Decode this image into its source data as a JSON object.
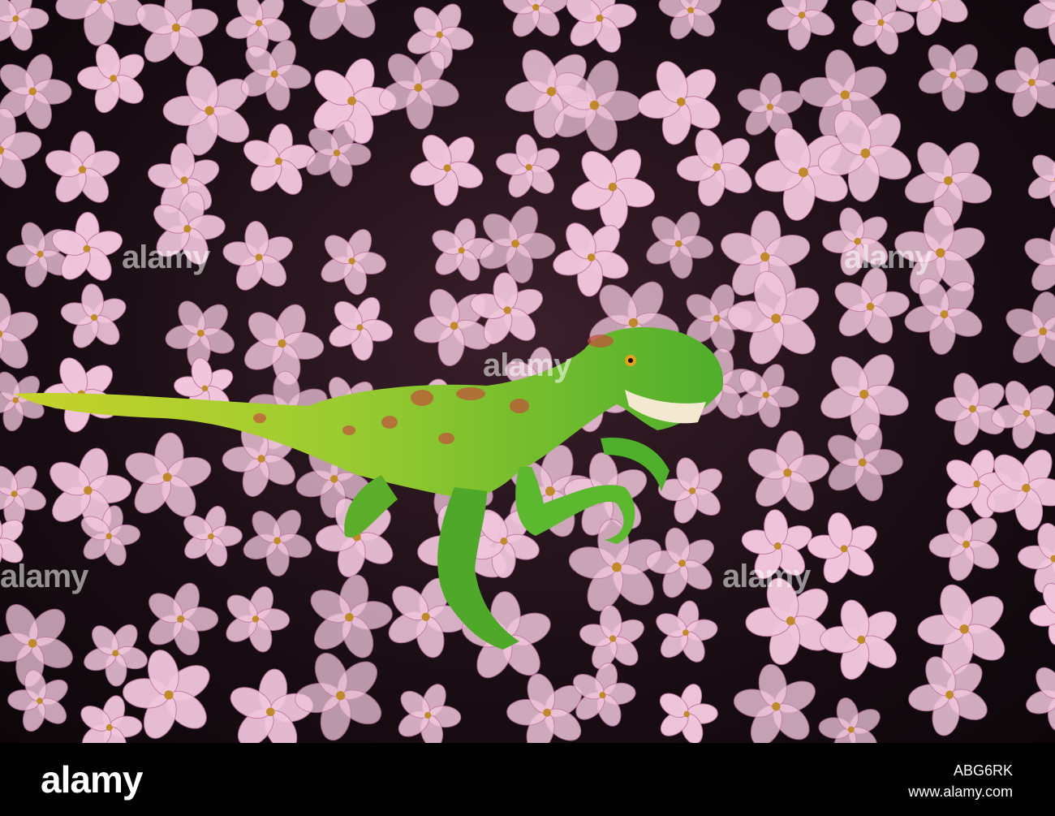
{
  "photo": {
    "subject": "toy-dinosaur-among-pink-flowers",
    "watermark_text": "alamy",
    "colors": {
      "flower": "#f1c6dc",
      "flower_edge": "#c27aa6",
      "center": "#c08a2a",
      "dino_green": "#5cb82e",
      "dino_yellow": "#c8d22a",
      "dino_stripe": "#c2503a"
    }
  },
  "footer": {
    "logo": "alamy",
    "image_id": "ABG6RK",
    "site_url": "www.alamy.com"
  }
}
